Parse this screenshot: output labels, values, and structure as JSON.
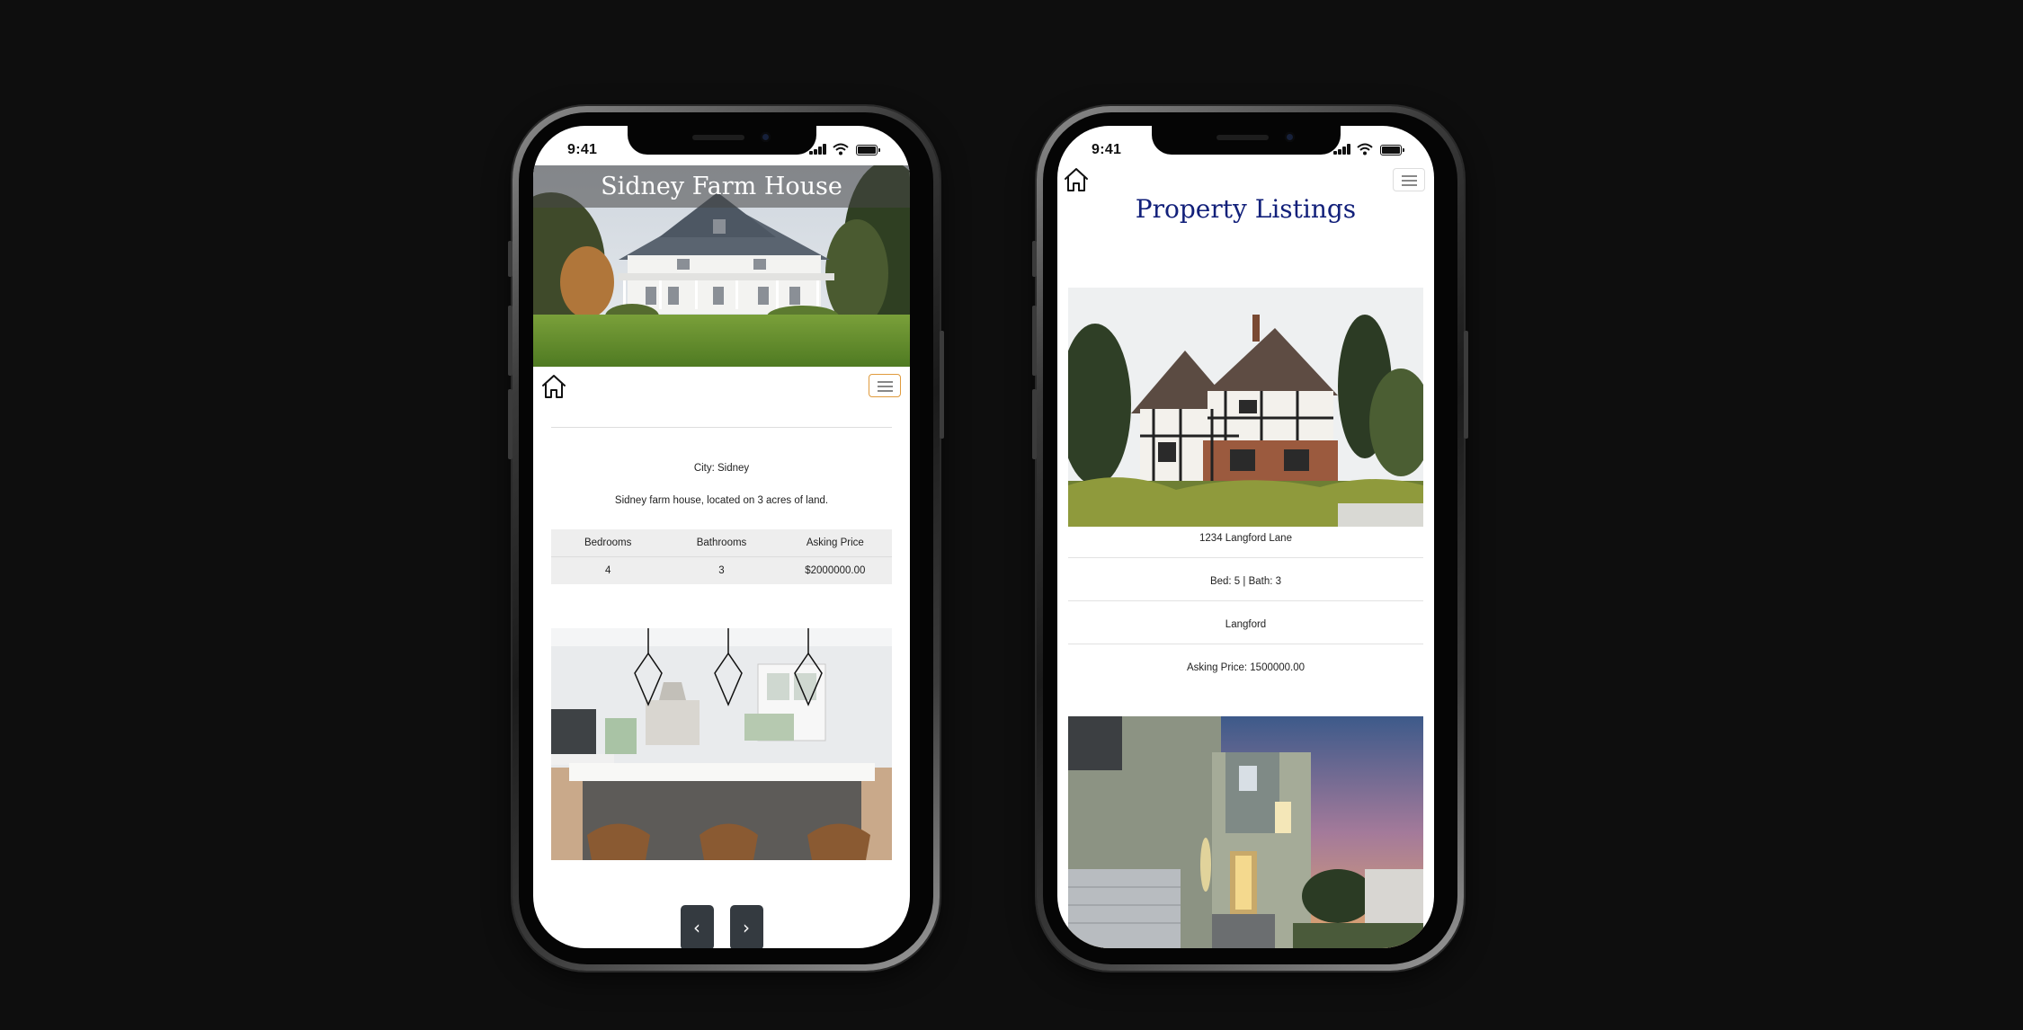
{
  "status": {
    "time": "9:41"
  },
  "detail": {
    "title": "Sidney Farm House",
    "city": "City: Sidney",
    "description": "Sidney farm house, located on 3 acres of land.",
    "table": {
      "headers": [
        "Bedrooms",
        "Bathrooms",
        "Asking Price"
      ],
      "row": [
        "4",
        "3",
        "$2000000.00"
      ]
    },
    "pager": {
      "prev": "‹",
      "next": "›"
    }
  },
  "listings": {
    "title": "Property Listings",
    "items": [
      {
        "address": "1234 Langford Lane",
        "bed_bath": "Bed: 5 | Bath: 3",
        "city": "Langford",
        "price": "Asking Price: 1500000.00"
      }
    ]
  },
  "colors": {
    "background": "#0e0e0e",
    "listings_title": "#12207a",
    "pager_button": "#343a40",
    "menu_border_active": "#e09b3d"
  },
  "icons": [
    "home-icon",
    "hamburger-menu-icon",
    "signal-icon",
    "wifi-icon",
    "battery-icon"
  ]
}
